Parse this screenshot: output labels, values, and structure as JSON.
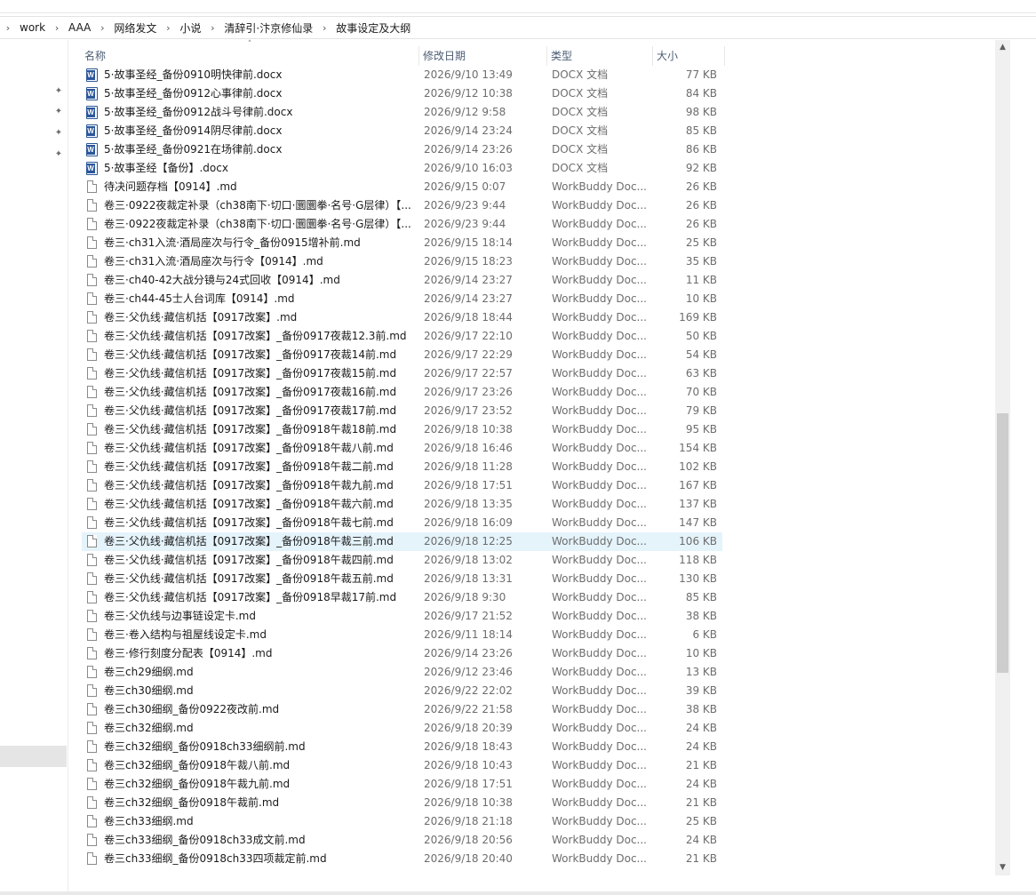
{
  "breadcrumb": [
    "work",
    "AAA",
    "网络发文",
    "小说",
    "清辞引·汴京修仙录",
    "故事设定及大纲"
  ],
  "columns": {
    "name": "名称",
    "date": "修改日期",
    "type": "类型",
    "size": "大小"
  },
  "files": [
    {
      "icon": "word",
      "name": "5·故事圣经_备份0910明快律前.docx",
      "date": "2026/9/10 13:49",
      "type": "DOCX 文档",
      "size": "77 KB"
    },
    {
      "icon": "word",
      "name": "5·故事圣经_备份0912心事律前.docx",
      "date": "2026/9/12 10:38",
      "type": "DOCX 文档",
      "size": "84 KB"
    },
    {
      "icon": "word",
      "name": "5·故事圣经_备份0912战斗号律前.docx",
      "date": "2026/9/12 9:58",
      "type": "DOCX 文档",
      "size": "98 KB"
    },
    {
      "icon": "word",
      "name": "5·故事圣经_备份0914阴尽律前.docx",
      "date": "2026/9/14 23:24",
      "type": "DOCX 文档",
      "size": "85 KB"
    },
    {
      "icon": "word",
      "name": "5·故事圣经_备份0921在场律前.docx",
      "date": "2026/9/14 23:26",
      "type": "DOCX 文档",
      "size": "86 KB"
    },
    {
      "icon": "word",
      "name": "5·故事圣经【备份】.docx",
      "date": "2026/9/10 16:03",
      "type": "DOCX 文档",
      "size": "92 KB"
    },
    {
      "icon": "doc",
      "name": "待决问题存档【0914】.md",
      "date": "2026/9/15 0:07",
      "type": "WorkBuddy Doc...",
      "size": "26 KB"
    },
    {
      "icon": "doc",
      "name": "卷三·0922夜裁定补录（ch38南下·切口·圜圜拳·名号·G层律）【...",
      "date": "2026/9/23 9:44",
      "type": "WorkBuddy Doc...",
      "size": "26 KB"
    },
    {
      "icon": "doc",
      "name": "卷三·0922夜裁定补录（ch38南下·切口·圜圜拳·名号·G层律）【...",
      "date": "2026/9/23 9:44",
      "type": "WorkBuddy Doc...",
      "size": "26 KB"
    },
    {
      "icon": "doc",
      "name": "卷三·ch31入流·酒局座次与行令_备份0915增补前.md",
      "date": "2026/9/15 18:14",
      "type": "WorkBuddy Doc...",
      "size": "25 KB"
    },
    {
      "icon": "doc",
      "name": "卷三·ch31入流·酒局座次与行令【0914】.md",
      "date": "2026/9/15 18:23",
      "type": "WorkBuddy Doc...",
      "size": "35 KB"
    },
    {
      "icon": "doc",
      "name": "卷三·ch40-42大战分镜与24式回收【0914】.md",
      "date": "2026/9/14 23:27",
      "type": "WorkBuddy Doc...",
      "size": "11 KB"
    },
    {
      "icon": "doc",
      "name": "卷三·ch44-45士人台词库【0914】.md",
      "date": "2026/9/14 23:27",
      "type": "WorkBuddy Doc...",
      "size": "10 KB"
    },
    {
      "icon": "doc",
      "name": "卷三·父仇线·藏信机括【0917改案】.md",
      "date": "2026/9/18 18:44",
      "type": "WorkBuddy Doc...",
      "size": "169 KB"
    },
    {
      "icon": "doc",
      "name": "卷三·父仇线·藏信机括【0917改案】_备份0917夜裁12.3前.md",
      "date": "2026/9/17 22:10",
      "type": "WorkBuddy Doc...",
      "size": "50 KB"
    },
    {
      "icon": "doc",
      "name": "卷三·父仇线·藏信机括【0917改案】_备份0917夜裁14前.md",
      "date": "2026/9/17 22:29",
      "type": "WorkBuddy Doc...",
      "size": "54 KB"
    },
    {
      "icon": "doc",
      "name": "卷三·父仇线·藏信机括【0917改案】_备份0917夜裁15前.md",
      "date": "2026/9/17 22:57",
      "type": "WorkBuddy Doc...",
      "size": "63 KB"
    },
    {
      "icon": "doc",
      "name": "卷三·父仇线·藏信机括【0917改案】_备份0917夜裁16前.md",
      "date": "2026/9/17 23:26",
      "type": "WorkBuddy Doc...",
      "size": "70 KB"
    },
    {
      "icon": "doc",
      "name": "卷三·父仇线·藏信机括【0917改案】_备份0917夜裁17前.md",
      "date": "2026/9/17 23:52",
      "type": "WorkBuddy Doc...",
      "size": "79 KB"
    },
    {
      "icon": "doc",
      "name": "卷三·父仇线·藏信机括【0917改案】_备份0918午裁18前.md",
      "date": "2026/9/18 10:38",
      "type": "WorkBuddy Doc...",
      "size": "95 KB"
    },
    {
      "icon": "doc",
      "name": "卷三·父仇线·藏信机括【0917改案】_备份0918午裁八前.md",
      "date": "2026/9/18 16:46",
      "type": "WorkBuddy Doc...",
      "size": "154 KB"
    },
    {
      "icon": "doc",
      "name": "卷三·父仇线·藏信机括【0917改案】_备份0918午裁二前.md",
      "date": "2026/9/18 11:28",
      "type": "WorkBuddy Doc...",
      "size": "102 KB"
    },
    {
      "icon": "doc",
      "name": "卷三·父仇线·藏信机括【0917改案】_备份0918午裁九前.md",
      "date": "2026/9/18 17:51",
      "type": "WorkBuddy Doc...",
      "size": "167 KB"
    },
    {
      "icon": "doc",
      "name": "卷三·父仇线·藏信机括【0917改案】_备份0918午裁六前.md",
      "date": "2026/9/18 13:35",
      "type": "WorkBuddy Doc...",
      "size": "137 KB"
    },
    {
      "icon": "doc",
      "name": "卷三·父仇线·藏信机括【0917改案】_备份0918午裁七前.md",
      "date": "2026/9/18 16:09",
      "type": "WorkBuddy Doc...",
      "size": "147 KB"
    },
    {
      "icon": "doc",
      "name": "卷三·父仇线·藏信机括【0917改案】_备份0918午裁三前.md",
      "date": "2026/9/18 12:25",
      "type": "WorkBuddy Doc...",
      "size": "106 KB",
      "selected": true
    },
    {
      "icon": "doc",
      "name": "卷三·父仇线·藏信机括【0917改案】_备份0918午裁四前.md",
      "date": "2026/9/18 13:02",
      "type": "WorkBuddy Doc...",
      "size": "118 KB"
    },
    {
      "icon": "doc",
      "name": "卷三·父仇线·藏信机括【0917改案】_备份0918午裁五前.md",
      "date": "2026/9/18 13:31",
      "type": "WorkBuddy Doc...",
      "size": "130 KB"
    },
    {
      "icon": "doc",
      "name": "卷三·父仇线·藏信机括【0917改案】_备份0918早裁17前.md",
      "date": "2026/9/18 9:30",
      "type": "WorkBuddy Doc...",
      "size": "85 KB"
    },
    {
      "icon": "doc",
      "name": "卷三·父仇线与边事链设定卡.md",
      "date": "2026/9/17 21:52",
      "type": "WorkBuddy Doc...",
      "size": "38 KB"
    },
    {
      "icon": "doc",
      "name": "卷三·卷入结构与祖屋线设定卡.md",
      "date": "2026/9/11 18:14",
      "type": "WorkBuddy Doc...",
      "size": "6 KB"
    },
    {
      "icon": "doc",
      "name": "卷三·修行刻度分配表【0914】.md",
      "date": "2026/9/14 23:26",
      "type": "WorkBuddy Doc...",
      "size": "10 KB"
    },
    {
      "icon": "doc",
      "name": "卷三ch29细纲.md",
      "date": "2026/9/12 23:46",
      "type": "WorkBuddy Doc...",
      "size": "13 KB"
    },
    {
      "icon": "doc",
      "name": "卷三ch30细纲.md",
      "date": "2026/9/22 22:02",
      "type": "WorkBuddy Doc...",
      "size": "39 KB"
    },
    {
      "icon": "doc",
      "name": "卷三ch30细纲_备份0922夜改前.md",
      "date": "2026/9/22 21:58",
      "type": "WorkBuddy Doc...",
      "size": "38 KB"
    },
    {
      "icon": "doc",
      "name": "卷三ch32细纲.md",
      "date": "2026/9/18 20:39",
      "type": "WorkBuddy Doc...",
      "size": "24 KB"
    },
    {
      "icon": "doc",
      "name": "卷三ch32细纲_备份0918ch33细纲前.md",
      "date": "2026/9/18 18:43",
      "type": "WorkBuddy Doc...",
      "size": "24 KB"
    },
    {
      "icon": "doc",
      "name": "卷三ch32细纲_备份0918午裁八前.md",
      "date": "2026/9/18 10:43",
      "type": "WorkBuddy Doc...",
      "size": "21 KB"
    },
    {
      "icon": "doc",
      "name": "卷三ch32细纲_备份0918午裁九前.md",
      "date": "2026/9/18 17:51",
      "type": "WorkBuddy Doc...",
      "size": "24 KB"
    },
    {
      "icon": "doc",
      "name": "卷三ch32细纲_备份0918午裁前.md",
      "date": "2026/9/18 10:38",
      "type": "WorkBuddy Doc...",
      "size": "21 KB"
    },
    {
      "icon": "doc",
      "name": "卷三ch33细纲.md",
      "date": "2026/9/18 21:18",
      "type": "WorkBuddy Doc...",
      "size": "25 KB"
    },
    {
      "icon": "doc",
      "name": "卷三ch33细纲_备份0918ch33成文前.md",
      "date": "2026/9/18 20:56",
      "type": "WorkBuddy Doc...",
      "size": "24 KB"
    },
    {
      "icon": "doc",
      "name": "卷三ch33细纲_备份0918ch33四项裁定前.md",
      "date": "2026/9/18 20:40",
      "type": "WorkBuddy Doc...",
      "size": "21 KB"
    }
  ],
  "icons": {
    "pin": "pin-icon",
    "word": "word-document-icon",
    "doc": "text-document-icon",
    "sort": "sort-ascending-icon"
  },
  "colors": {
    "selected_row": "#e5f3fb",
    "header_text": "#4b5c74",
    "word_blue": "#2b579a"
  },
  "glyphs": {
    "crumb_sep": "›",
    "pin": "✦",
    "sort": "˄",
    "scroll_up": "▲",
    "scroll_down": "▼"
  }
}
